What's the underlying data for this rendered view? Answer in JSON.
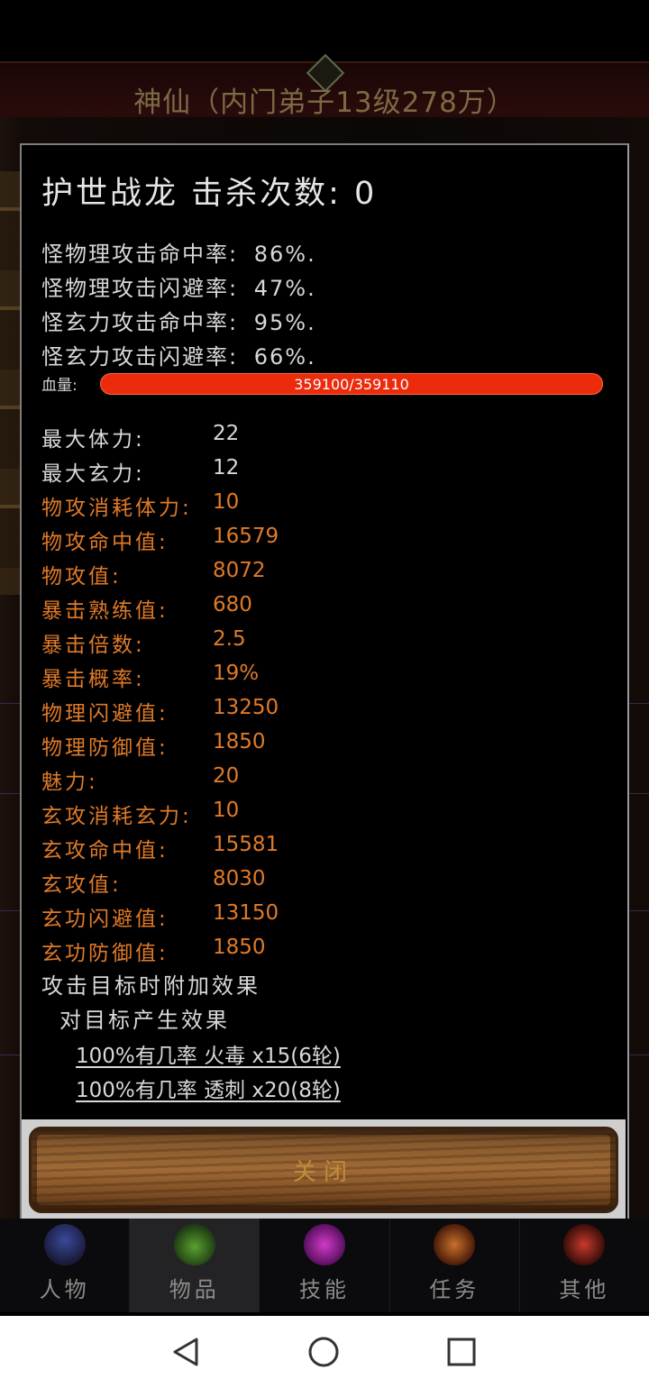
{
  "background": {
    "title": "神仙（内门弟子13级278万）"
  },
  "monster": {
    "title": "护世战龙  击杀次数: 0"
  },
  "rates": [
    {
      "label": "怪物理攻击命中率:",
      "value": "86%."
    },
    {
      "label": "怪物理攻击闪避率:",
      "value": "47%."
    },
    {
      "label": "怪玄力攻击命中率:",
      "value": "95%."
    },
    {
      "label": "怪玄力攻击闪避率:",
      "value": "66%."
    }
  ],
  "hp": {
    "label": "血量:",
    "text": "359100/359110",
    "fraction": 0.99997
  },
  "stats": [
    {
      "label": "最大体力:",
      "value": "22",
      "color": "white"
    },
    {
      "label": "最大玄力:",
      "value": "12",
      "color": "white"
    },
    {
      "label": "物攻消耗体力:",
      "value": "10",
      "color": "orange"
    },
    {
      "label": "物攻命中值:",
      "value": "16579",
      "color": "orange"
    },
    {
      "label": "物攻值:",
      "value": "8072",
      "color": "orange"
    },
    {
      "label": "暴击熟练值:",
      "value": "680",
      "color": "orange"
    },
    {
      "label": "暴击倍数:",
      "value": "2.5",
      "color": "orange"
    },
    {
      "label": "暴击概率:",
      "value": "19%",
      "color": "orange"
    },
    {
      "label": "物理闪避值:",
      "value": "13250",
      "color": "orange"
    },
    {
      "label": "物理防御值:",
      "value": "1850",
      "color": "orange"
    },
    {
      "label": "魅力:",
      "value": "20",
      "color": "orange"
    },
    {
      "label": "玄攻消耗玄力:",
      "value": "10",
      "color": "orange"
    },
    {
      "label": "玄攻命中值:",
      "value": "15581",
      "color": "orange"
    },
    {
      "label": "玄攻值:",
      "value": "8030",
      "color": "orange"
    },
    {
      "label": "玄功闪避值:",
      "value": "13150",
      "color": "orange"
    },
    {
      "label": "玄功防御值:",
      "value": "1850",
      "color": "orange"
    }
  ],
  "effects": {
    "heading": "攻击目标时附加效果",
    "subheading": "对目标产生效果",
    "items": [
      "100%有几率 火毒 x15(6轮)",
      "100%有几率 透刺 x20(8轮)"
    ]
  },
  "close_button": {
    "label": "关闭"
  },
  "nav": [
    {
      "label": "人物",
      "icon": "character-icon"
    },
    {
      "label": "物品",
      "icon": "bag-icon"
    },
    {
      "label": "技能",
      "icon": "skill-orb-icon"
    },
    {
      "label": "任务",
      "icon": "quest-icon"
    },
    {
      "label": "其他",
      "icon": "sword-icon"
    }
  ],
  "colors": {
    "orange_text": "#e07a28",
    "white_text": "#d8d8d8",
    "hp_bar": "#ec2a0c"
  }
}
